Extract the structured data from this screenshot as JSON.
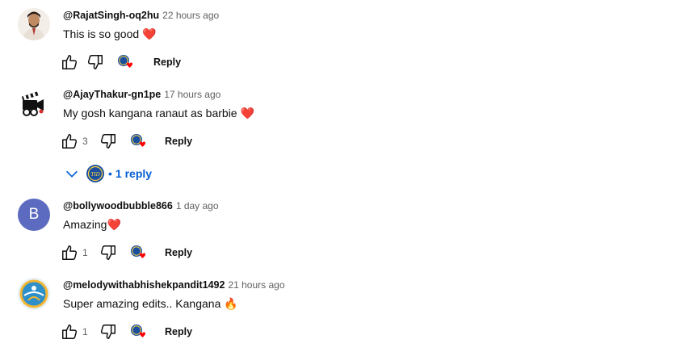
{
  "comments": [
    {
      "author": "@RajatSingh-oq2hu",
      "time": "22 hours ago",
      "text": "This is so good",
      "emoji": "❤️",
      "likes": "",
      "reply_label": "Reply"
    },
    {
      "author": "@AjayThakur-gn1pe",
      "time": "17 hours ago",
      "text": "My gosh kangana ranaut as barbie",
      "emoji": "❤️",
      "likes": "3",
      "reply_label": "Reply",
      "replies_label": "1 reply"
    },
    {
      "author": "@bollywoodbubble866",
      "time": "1 day ago",
      "text": "Amazing",
      "emoji": "❤️",
      "avatar_letter": "B",
      "likes": "1",
      "reply_label": "Reply"
    },
    {
      "author": "@melodywithabhishekpandit1492",
      "time": "21 hours ago",
      "text": "Super amazing edits.. Kangana",
      "emoji": "🔥",
      "likes": "1",
      "reply_label": "Reply"
    }
  ],
  "colors": {
    "link_blue": "#065fd4",
    "heart_red": "#e4252b",
    "avatar_b_bg": "#5c6bc0",
    "muted": "#606060"
  },
  "icons": [
    "like-icon",
    "dislike-icon",
    "creator-heart-icon",
    "chevron-down-icon"
  ]
}
